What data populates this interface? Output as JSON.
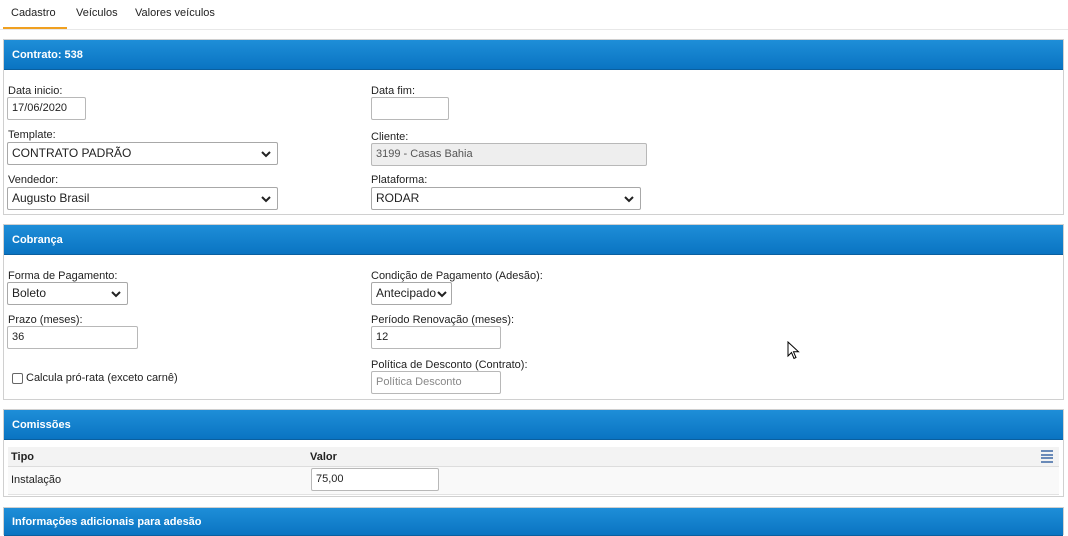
{
  "tabs": [
    "Cadastro",
    "Veículos",
    "Valores veículos"
  ],
  "contract": {
    "title": "Contrato: 538",
    "data_inicio_label": "Data inicio:",
    "data_inicio_value": "17/06/2020",
    "data_fim_label": "Data fim:",
    "data_fim_value": "",
    "template_label": "Template:",
    "template_value": "CONTRATO PADRÃO",
    "cliente_label": "Cliente:",
    "cliente_value": "3199 - Casas Bahia",
    "vendedor_label": "Vendedor:",
    "vendedor_value": "Augusto Brasil",
    "plataforma_label": "Plataforma:",
    "plataforma_value": "RODAR"
  },
  "cobranca": {
    "title": "Cobrança",
    "forma_label": "Forma de Pagamento:",
    "forma_value": "Boleto",
    "condicao_label": "Condição de Pagamento (Adesão):",
    "condicao_value": "Antecipado",
    "prazo_label": "Prazo (meses):",
    "prazo_value": "36",
    "periodo_label": "Período Renovação (meses):",
    "periodo_value": "12",
    "prorata_label": "Calcula pró-rata (exceto carnê)",
    "prorata_checked": false,
    "politica_label": "Política de Desconto (Contrato):",
    "politica_placeholder": "Política Desconto"
  },
  "comissoes": {
    "title": "Comissões",
    "columns": [
      "Tipo",
      "Valor"
    ],
    "rows": [
      {
        "tipo": "Instalação",
        "valor": "75,00"
      }
    ]
  },
  "info_adicionais": {
    "title": "Informações adicionais para adesão"
  },
  "colors": {
    "header_blue": "#0a74c2",
    "tab_accent": "#f0a020"
  }
}
